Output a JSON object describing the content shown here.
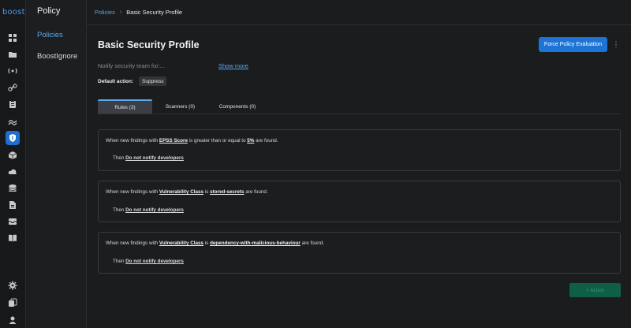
{
  "app": {
    "brand": "boost"
  },
  "rail": {
    "icons": [
      "dashboard-icon",
      "folder-icon",
      "broadcast-icon",
      "link-icon",
      "clipboard-icon",
      "trend-icon",
      "shield-icon",
      "cube-icon",
      "cloud-icon",
      "database-icon",
      "document-icon",
      "inbox-icon",
      "book-icon",
      "settings-icon",
      "copy-icon",
      "user-icon"
    ],
    "active_icon": "shield-icon",
    "accent": "#1e6fd0"
  },
  "sidebar": {
    "title": "Policy",
    "items": [
      {
        "label": "Policies",
        "active": true
      },
      {
        "label": "BoostIgnore",
        "active": false
      }
    ]
  },
  "breadcrumb": {
    "parent": "Policies",
    "current": "Basic Security Profile"
  },
  "page": {
    "title": "Basic Security Profile",
    "primary_button": "Force Policy Evaluation",
    "description": "Notify security team for:...",
    "show_more": "Show more",
    "default_action_label": "Default action:",
    "default_action_value": "Suppress"
  },
  "tabs": [
    {
      "label": "Rules (3)",
      "active": true
    },
    {
      "label": "Scanners (0)",
      "active": false
    },
    {
      "label": "Components (0)",
      "active": false
    }
  ],
  "rules": [
    {
      "prefix": "When new findings with",
      "field": "EPSS Score",
      "operator": "is greater than or equal to",
      "value": "5%",
      "suffix": "are found.",
      "then_label": "Then",
      "action": "Do not notify developers"
    },
    {
      "prefix": "When new findings with",
      "field": "Vulnerability Class",
      "operator": "is",
      "value": "stored-secrets",
      "suffix": "are found.",
      "then_label": "Then",
      "action": "Do not notify developers"
    },
    {
      "prefix": "When new findings with",
      "field": "Vulnerability Class",
      "operator": "is",
      "value": "dependency-with-malicious-behaviour",
      "suffix": "are found.",
      "then_label": "Then",
      "action": "Do not notify developers"
    }
  ],
  "add_action": "+ Action",
  "colors": {
    "primary": "#1e74d6",
    "link": "#5aa7ee",
    "add_button": "#0f5f48"
  }
}
